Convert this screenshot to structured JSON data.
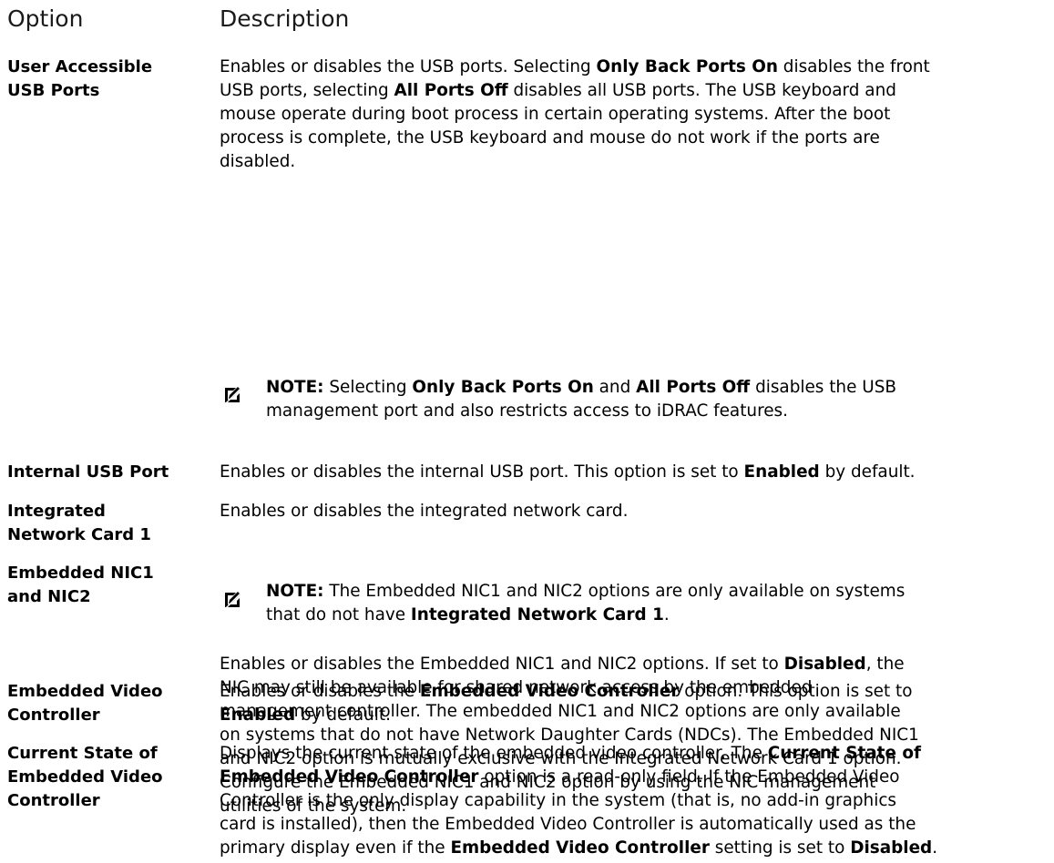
{
  "header": {
    "option": "Option",
    "description": "Description"
  },
  "rows": [
    {
      "label_lines": [
        "User Accessible",
        "USB Ports"
      ],
      "desc_lines": [
        [
          {
            "t": "Enables or disables the USB ports. Selecting "
          },
          {
            "t": "Only Back Ports On",
            "b": true
          },
          {
            "t": " disables the front"
          }
        ],
        [
          {
            "t": "USB ports, selecting "
          },
          {
            "t": "All Ports Off",
            "b": true
          },
          {
            "t": " disables all USB ports. The USB keyboard and"
          }
        ],
        [
          {
            "t": "mouse operate during boot process in certain operating systems. After the boot"
          }
        ],
        [
          {
            "t": "process is complete, the USB keyboard and mouse do not work if the ports are"
          }
        ],
        [
          {
            "t": "disabled."
          }
        ]
      ],
      "note": {
        "keyword": "NOTE:",
        "lines": [
          [
            {
              "t": " Selecting "
            },
            {
              "t": "Only Back Ports On",
              "b": true
            },
            {
              "t": " and "
            },
            {
              "t": "All Ports Off",
              "b": true
            },
            {
              "t": " disables the USB"
            }
          ],
          [
            {
              "t": "management port and also restricts access to iDRAC features."
            }
          ]
        ]
      }
    },
    {
      "label_lines": [
        "Internal USB Port"
      ],
      "desc_lines": [
        [
          {
            "t": "Enables or disables the internal USB port. This option is set to "
          },
          {
            "t": "Enabled",
            "b": true
          },
          {
            "t": " by default."
          }
        ]
      ]
    },
    {
      "label_lines": [
        "Integrated",
        "Network Card 1"
      ],
      "desc_lines": [
        [
          {
            "t": "Enables or disables the integrated network card."
          }
        ]
      ]
    },
    {
      "label_lines": [
        "Embedded NIC1",
        "and NIC2"
      ],
      "note": {
        "keyword": "NOTE:",
        "lines": [
          [
            {
              "t": " The Embedded NIC1 and NIC2 options are only available on systems"
            }
          ],
          [
            {
              "t": "that do not have "
            },
            {
              "t": "Integrated Network Card 1",
              "b": true
            },
            {
              "t": "."
            }
          ]
        ]
      },
      "desc_lines": [
        [
          {
            "t": "Enables or disables the Embedded NIC1 and NIC2 options. If set to "
          },
          {
            "t": "Disabled",
            "b": true
          },
          {
            "t": ", the"
          }
        ],
        [
          {
            "t": "NIC may still be available for shared network access by the embedded"
          }
        ],
        [
          {
            "t": "management controller. The embedded NIC1 and NIC2 options are only available"
          }
        ],
        [
          {
            "t": "on systems that do not have Network Daughter Cards (NDCs). The Embedded NIC1"
          }
        ],
        [
          {
            "t": "and NIC2 option is mutually exclusive with the Integrated Network Card 1 option."
          }
        ],
        [
          {
            "t": "Configure the Embedded NIC1 and NIC2 option by using the NIC management"
          }
        ],
        [
          {
            "t": "utilities of the system."
          }
        ]
      ]
    },
    {
      "label_lines": [
        "Embedded Video",
        "Controller"
      ],
      "desc_lines": [
        [
          {
            "t": "Enables or disables the "
          },
          {
            "t": "Embedded Video Controller",
            "b": true
          },
          {
            "t": " option. This option is set to"
          }
        ],
        [
          {
            "t": "Enabled",
            "b": true
          },
          {
            "t": " by default."
          }
        ]
      ]
    },
    {
      "label_lines": [
        "Current State of",
        "Embedded Video",
        "Controller"
      ],
      "desc_lines": [
        [
          {
            "t": "Displays the current state of the embedded video controller. The "
          },
          {
            "t": "Current State of",
            "b": true
          }
        ],
        [
          {
            "t": "Embedded Video Controller",
            "b": true
          },
          {
            "t": " option is a read-only field. If the Embedded Video"
          }
        ],
        [
          {
            "t": "Controller is the only display capability in the system (that is, no add-in graphics"
          }
        ],
        [
          {
            "t": "card is installed), then the Embedded Video Controller is automatically used as the"
          }
        ],
        [
          {
            "t": "primary display even if the "
          },
          {
            "t": "Embedded Video Controller",
            "b": true
          },
          {
            "t": " setting is set to "
          },
          {
            "t": "Disabled",
            "b": true
          },
          {
            "t": "."
          }
        ]
      ]
    }
  ]
}
